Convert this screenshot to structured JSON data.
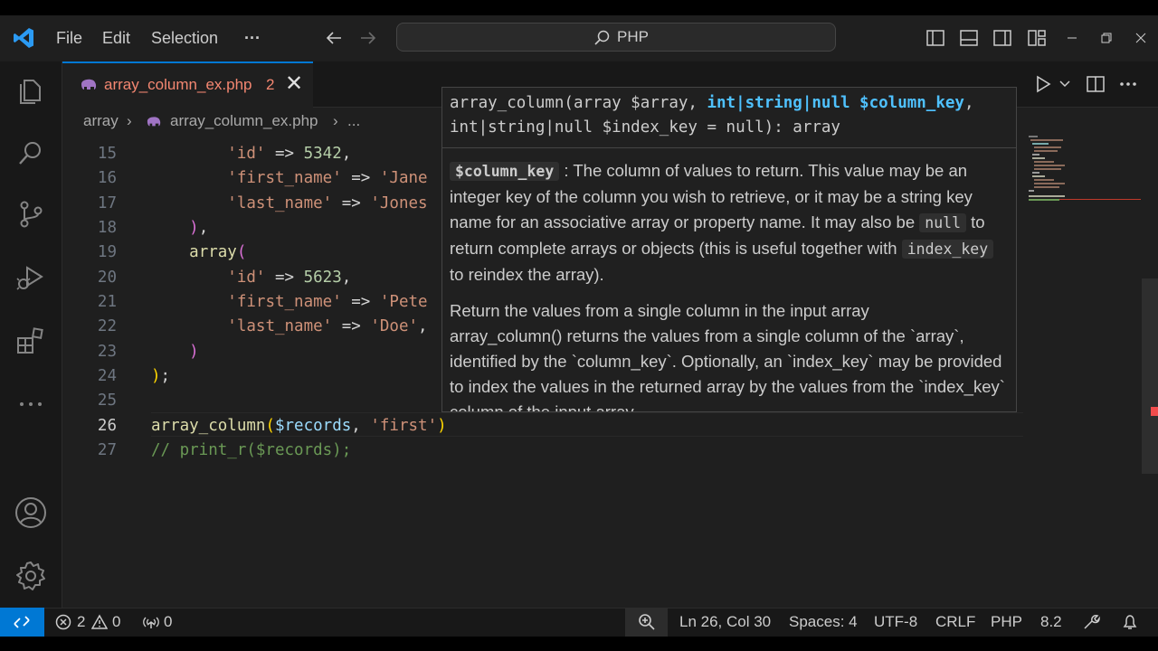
{
  "menu": {
    "file": "File",
    "edit": "Edit",
    "selection": "Selection",
    "more": "···"
  },
  "command_center": {
    "text": "PHP"
  },
  "tab": {
    "label": "array_column_ex.php",
    "problems": "2",
    "close": "✕"
  },
  "breadcrumb": {
    "folder": "array",
    "file": "array_column_ex.php",
    "more": "..."
  },
  "editor": {
    "lines": [
      {
        "num": "15",
        "tokens": [
          [
            "p",
            "        "
          ],
          [
            "s",
            "'id'"
          ],
          [
            "p",
            " => "
          ],
          [
            "n",
            "5342"
          ],
          [
            "p",
            ","
          ]
        ]
      },
      {
        "num": "16",
        "tokens": [
          [
            "p",
            "        "
          ],
          [
            "s",
            "'first_name'"
          ],
          [
            "p",
            " => "
          ],
          [
            "s",
            "'Jane"
          ]
        ]
      },
      {
        "num": "17",
        "tokens": [
          [
            "p",
            "        "
          ],
          [
            "s",
            "'last_name'"
          ],
          [
            "p",
            " => "
          ],
          [
            "s",
            "'Jones"
          ]
        ]
      },
      {
        "num": "18",
        "tokens": [
          [
            "p",
            "    "
          ],
          [
            "b1",
            ")"
          ],
          [
            "p",
            ","
          ]
        ]
      },
      {
        "num": "19",
        "tokens": [
          [
            "p",
            "    "
          ],
          [
            "f",
            "array"
          ],
          [
            "b1",
            "("
          ]
        ]
      },
      {
        "num": "20",
        "tokens": [
          [
            "p",
            "        "
          ],
          [
            "s",
            "'id'"
          ],
          [
            "p",
            " => "
          ],
          [
            "n",
            "5623"
          ],
          [
            "p",
            ","
          ]
        ]
      },
      {
        "num": "21",
        "tokens": [
          [
            "p",
            "        "
          ],
          [
            "s",
            "'first_name'"
          ],
          [
            "p",
            " => "
          ],
          [
            "s",
            "'Pete"
          ]
        ]
      },
      {
        "num": "22",
        "tokens": [
          [
            "p",
            "        "
          ],
          [
            "s",
            "'last_name'"
          ],
          [
            "p",
            " => "
          ],
          [
            "s",
            "'Doe'"
          ],
          [
            "p",
            ","
          ]
        ]
      },
      {
        "num": "23",
        "tokens": [
          [
            "p",
            "    "
          ],
          [
            "b1",
            ")"
          ]
        ]
      },
      {
        "num": "24",
        "tokens": [
          [
            "b2",
            ")"
          ],
          [
            "p",
            ";"
          ]
        ]
      },
      {
        "num": "25",
        "tokens": []
      },
      {
        "num": "26",
        "tokens": [
          [
            "f",
            "array_column"
          ],
          [
            "b2",
            "("
          ],
          [
            "k",
            "$records"
          ],
          [
            "p",
            ", "
          ],
          [
            "s",
            "'first'"
          ],
          [
            "b2",
            ")"
          ]
        ]
      },
      {
        "num": "27",
        "tokens": [
          [
            "c",
            "// print_r($records);"
          ]
        ]
      }
    ],
    "current_line": "26"
  },
  "hover": {
    "sig_part1": "array_column(array $array, ",
    "sig_highlight": "int|string|null $column_key",
    "sig_part2": ",",
    "sig_line2": "int|string|null $index_key = null): array",
    "param_name": "$column_key",
    "param_desc_1": " : The column of values to return. This value may be an integer key of the column you wish to retrieve, or it may be a string key name for an associative array or property name. It may also be ",
    "null_chip": "null",
    "param_desc_2": " to return complete arrays or objects (this is useful together with ",
    "index_key_chip": "index_key",
    "param_desc_3": " to reindex the array).",
    "summary": "Return the values from a single column in the input array",
    "description": "array_column() returns the values from a single column of the `array`, identified by the `column_key`. Optionally, an `index_key` may be provided to index the values in the returned array by the values from the `index_key` column of the input array."
  },
  "status": {
    "errors": "2",
    "warnings": "0",
    "ports": "0",
    "position": "Ln 26, Col 30",
    "spaces": "Spaces: 4",
    "encoding": "UTF-8",
    "eol": "CRLF",
    "language": "PHP",
    "version": "8.2"
  },
  "colors": {
    "accent": "#0078d4",
    "tab_error": "#f48771",
    "background": "#1f1f1f"
  },
  "icons": [
    "vscode-logo-icon",
    "back-arrow-icon",
    "forward-arrow-icon",
    "search-icon",
    "toggle-sidebar-icon",
    "toggle-panel-icon",
    "toggle-secondary-sidebar-icon",
    "customize-layout-icon",
    "minimize-icon",
    "restore-icon",
    "close-icon",
    "php-elephant-icon",
    "run-icon",
    "chevron-down-icon",
    "split-editor-icon",
    "more-actions-icon",
    "explorer-icon",
    "search-view-icon",
    "source-control-icon",
    "run-debug-icon",
    "extensions-icon",
    "more-icon",
    "accounts-icon",
    "settings-gear-icon",
    "remote-icon",
    "error-icon",
    "warning-icon",
    "ports-icon",
    "zoom-icon",
    "format-icon",
    "bell-icon"
  ]
}
